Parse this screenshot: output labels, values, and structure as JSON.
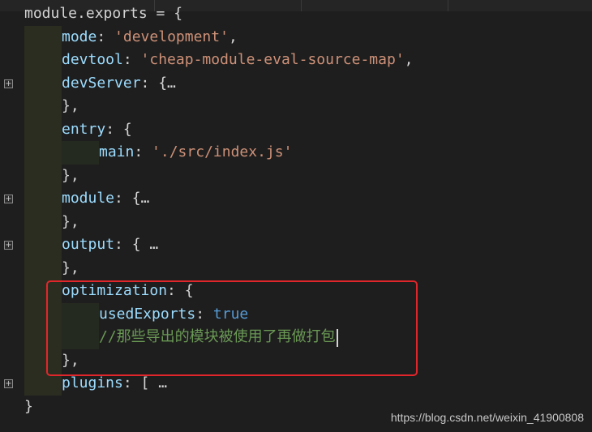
{
  "editor": {
    "lines": [
      {
        "parts": [
          {
            "t": "p",
            "v": "module.exports = {"
          }
        ]
      },
      {
        "parts": [
          {
            "t": "k",
            "v": "mode"
          },
          {
            "t": "p",
            "v": ": "
          },
          {
            "t": "s",
            "v": "'development'"
          },
          {
            "t": "p",
            "v": ","
          }
        ]
      },
      {
        "parts": [
          {
            "t": "k",
            "v": "devtool"
          },
          {
            "t": "p",
            "v": ": "
          },
          {
            "t": "s",
            "v": "'cheap-module-eval-source-map'"
          },
          {
            "t": "p",
            "v": ","
          }
        ]
      },
      {
        "parts": [
          {
            "t": "k",
            "v": "devServer"
          },
          {
            "t": "p",
            "v": ": {…"
          }
        ]
      },
      {
        "parts": [
          {
            "t": "p",
            "v": "},"
          }
        ]
      },
      {
        "parts": [
          {
            "t": "k",
            "v": "entry"
          },
          {
            "t": "p",
            "v": ": {"
          }
        ]
      },
      {
        "parts": [
          {
            "t": "k",
            "v": "main"
          },
          {
            "t": "p",
            "v": ": "
          },
          {
            "t": "s",
            "v": "'./src/index.js'"
          }
        ]
      },
      {
        "parts": [
          {
            "t": "p",
            "v": "},"
          }
        ]
      },
      {
        "parts": [
          {
            "t": "k",
            "v": "module"
          },
          {
            "t": "p",
            "v": ": {…"
          }
        ]
      },
      {
        "parts": [
          {
            "t": "p",
            "v": "},"
          }
        ]
      },
      {
        "parts": [
          {
            "t": "k",
            "v": "output"
          },
          {
            "t": "p",
            "v": ": { …"
          }
        ]
      },
      {
        "parts": [
          {
            "t": "p",
            "v": "},"
          }
        ]
      },
      {
        "parts": [
          {
            "t": "k",
            "v": "optimization"
          },
          {
            "t": "p",
            "v": ": {"
          }
        ]
      },
      {
        "parts": [
          {
            "t": "k",
            "v": "usedExports"
          },
          {
            "t": "p",
            "v": ": "
          },
          {
            "t": "b",
            "v": "true"
          }
        ]
      },
      {
        "parts": [
          {
            "t": "c",
            "v": "//那些导出的模块被使用了再做打包"
          }
        ]
      },
      {
        "parts": [
          {
            "t": "p",
            "v": "},"
          }
        ]
      },
      {
        "parts": [
          {
            "t": "k",
            "v": "plugins"
          },
          {
            "t": "p",
            "v": ": [ …"
          }
        ]
      },
      {
        "parts": [
          {
            "t": "p",
            "v": "}"
          }
        ]
      }
    ],
    "fold_glyph": "+"
  },
  "highlight_color": "#e0262a",
  "watermark": "https://blog.csdn.net/weixin_41900808"
}
